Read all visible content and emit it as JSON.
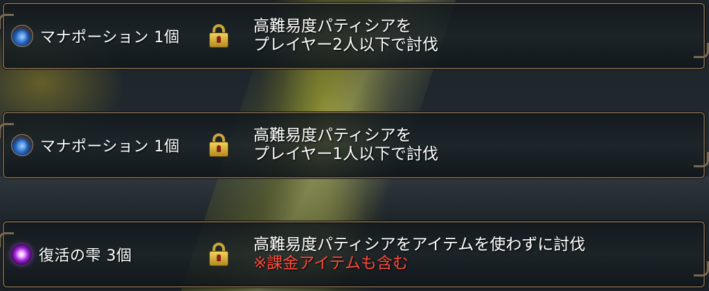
{
  "missions": [
    {
      "reward_icon": "mana-potion-icon",
      "reward_label": "マナポーション 1個",
      "lock_icon": "padlock-icon",
      "condition_line1": "高難易度パティシアを",
      "condition_line2": "プレイヤー2人以下で討伐"
    },
    {
      "reward_icon": "mana-potion-icon",
      "reward_label": "マナポーション 1個",
      "lock_icon": "padlock-icon",
      "condition_line1": "高難易度パティシアを",
      "condition_line2": "プレイヤー1人以下で討伐"
    },
    {
      "reward_icon": "revival-drop-icon",
      "reward_label": "復活の雫 3個",
      "lock_icon": "padlock-icon",
      "condition_line1": "高難易度パティシアをアイテムを使わずに討伐",
      "condition_note": "※課金アイテムも含む"
    }
  ],
  "colors": {
    "text": "#ffffff",
    "note": "#ff4a3a",
    "frame": "#6b5b46",
    "lock": "#e2c14a"
  }
}
